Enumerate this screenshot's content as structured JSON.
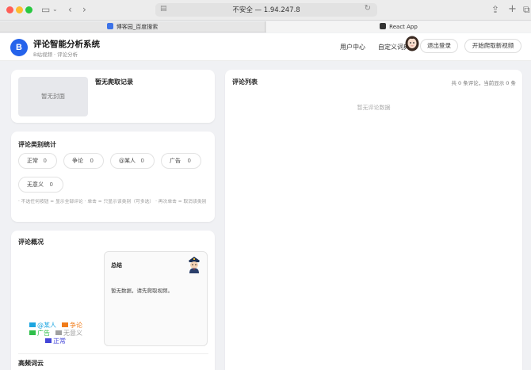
{
  "browser": {
    "address_text": "不安全 — 1.94.247.8",
    "tabs": [
      {
        "label": "博客园_百度搜索"
      },
      {
        "label": "React App"
      }
    ]
  },
  "header": {
    "logo_letter": "B",
    "title": "评论智能分析系统",
    "subtitle": "B站视频 · 评论分析",
    "nav": [
      "用户中心",
      "自定义词典"
    ],
    "logout_label": "退出登录",
    "crawl_label": "开始爬取新视频"
  },
  "video_card": {
    "cover_placeholder": "暂无封面",
    "title": "暂无爬取记录"
  },
  "category_card": {
    "title": "评论类别统计",
    "chips": [
      {
        "label": "正常",
        "count": "0"
      },
      {
        "label": "争论",
        "count": "0"
      },
      {
        "label": "@某人",
        "count": "0"
      },
      {
        "label": "广告",
        "count": "0"
      },
      {
        "label": "无意义",
        "count": "0"
      }
    ],
    "hint": "· 不选任何按钮 = 显示全部评论 · 单击 = 只显示该类别（可多选） · 再次单击 = 取消该类别"
  },
  "overview_card": {
    "title": "评论概况",
    "summary_title": "总结",
    "summary_text": "暂无数据，请先爬取视频。",
    "legend": [
      {
        "label": "@某人",
        "color": "#1ba5e0"
      },
      {
        "label": "争论",
        "color": "#f07c1a"
      },
      {
        "label": "广告",
        "color": "#2fbf4a"
      },
      {
        "label": "无意义",
        "color": "#a0a0a0"
      },
      {
        "label": "正常",
        "color": "#4446d8"
      }
    ],
    "word_cloud_title": "高频词云"
  },
  "comments_card": {
    "title": "评论列表",
    "count_text": "共 0 条评论，当前显示 0 条",
    "empty_text": "暂无评论数据"
  }
}
